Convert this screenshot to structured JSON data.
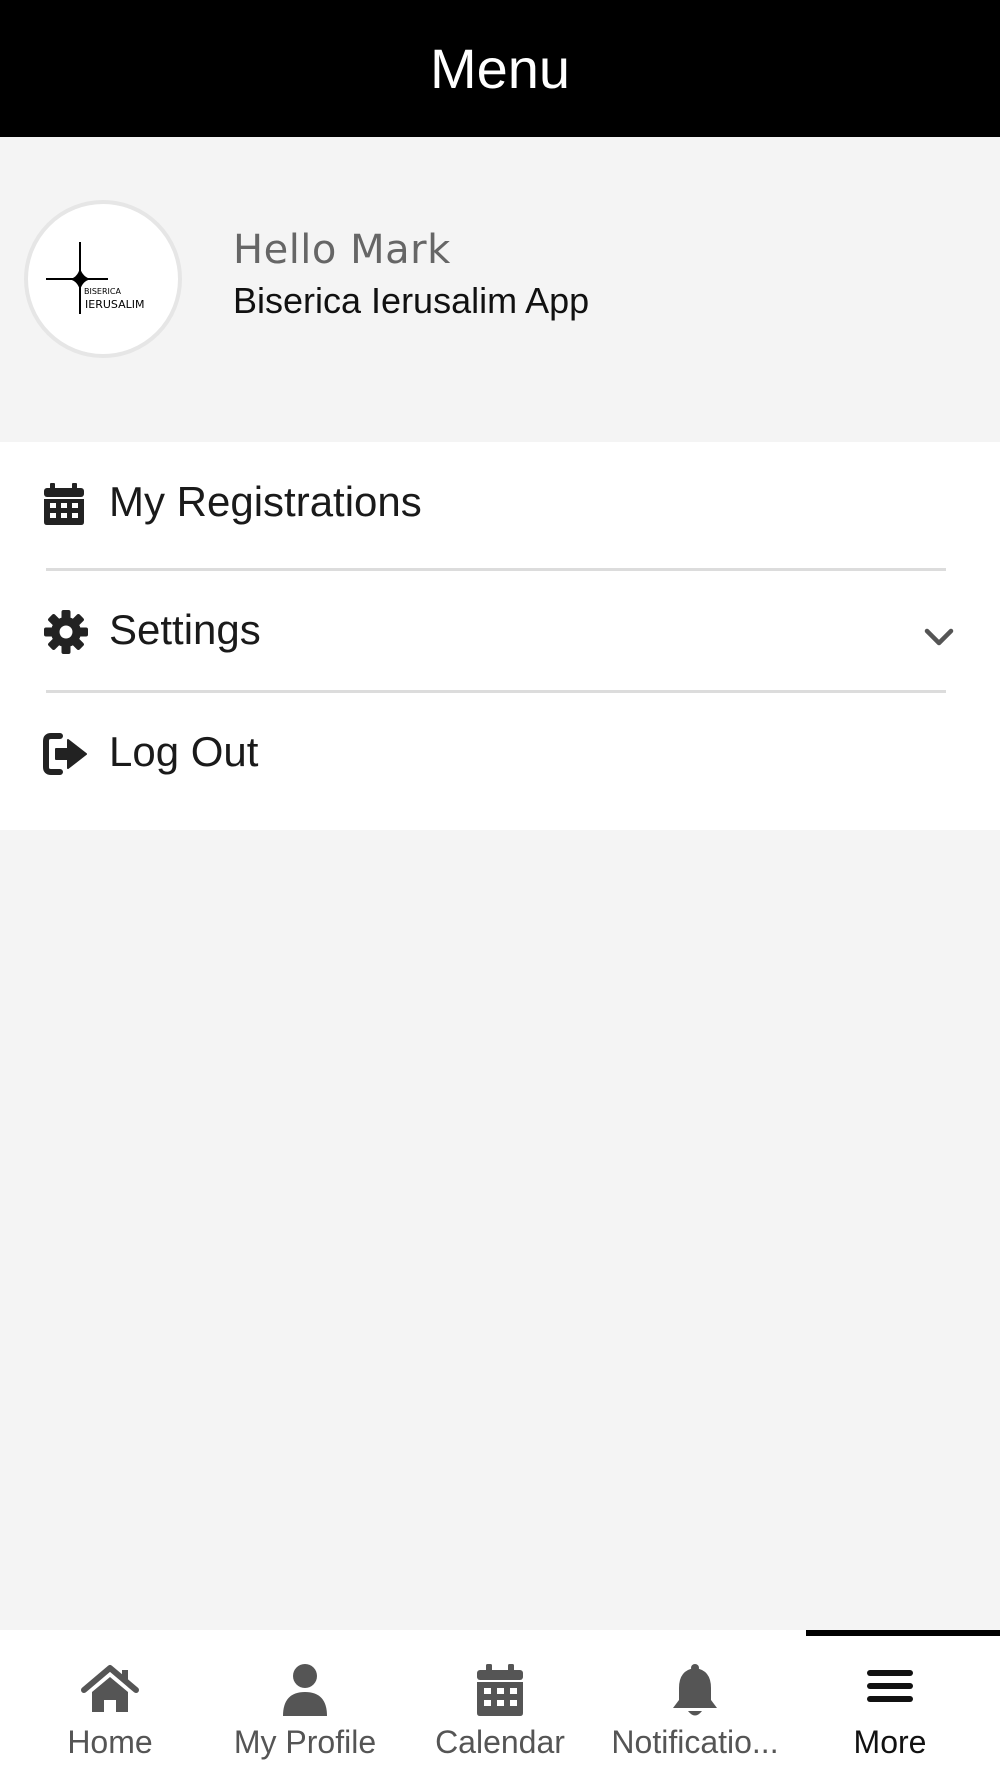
{
  "header": {
    "title": "Menu"
  },
  "profile": {
    "greeting": "Hello Mark",
    "app_name": "Biserica Ierusalim App",
    "logo": {
      "line1": "BISERICA",
      "line2": "IERUSALIM"
    }
  },
  "menu": {
    "items": [
      {
        "label": "My Registrations",
        "icon": "calendar-icon"
      },
      {
        "label": "Settings",
        "icon": "gear-icon",
        "expandable": true
      },
      {
        "label": "Log Out",
        "icon": "sign-out-icon"
      }
    ]
  },
  "tabbar": {
    "active": "More",
    "tabs": [
      {
        "label": "Home",
        "icon": "home-icon"
      },
      {
        "label": "My Profile",
        "icon": "user-icon"
      },
      {
        "label": "Calendar",
        "icon": "calendar-icon"
      },
      {
        "label": "Notificatio...",
        "icon": "bell-icon"
      },
      {
        "label": "More",
        "icon": "menu-icon"
      }
    ]
  },
  "colors": {
    "header_bg": "#000000",
    "page_bg": "#f4f4f4",
    "icon_gray": "#555555",
    "active": "#111111"
  }
}
